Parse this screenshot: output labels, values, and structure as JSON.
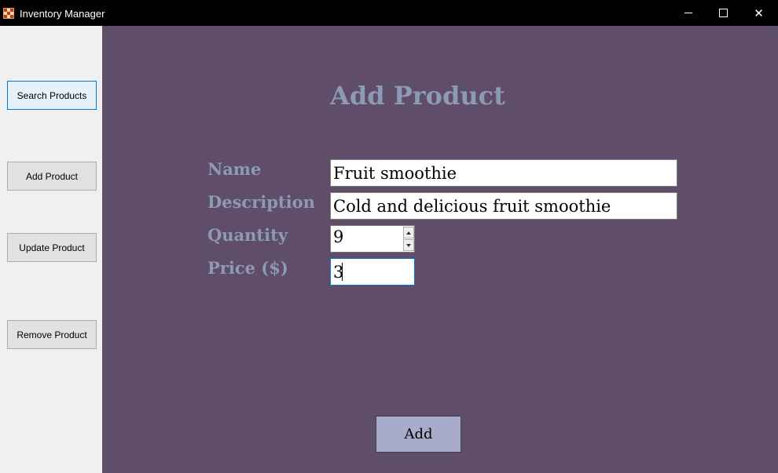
{
  "window": {
    "title": "Inventory Manager",
    "controls": {
      "minimize": "minimize-icon",
      "maximize": "maximize-icon",
      "close": "close-icon",
      "close_glyph": "✕"
    }
  },
  "sidebar": {
    "buttons": [
      {
        "label": "Search Products"
      },
      {
        "label": "Add Product"
      },
      {
        "label": "Update Product"
      },
      {
        "label": "Remove Product"
      }
    ]
  },
  "form": {
    "heading": "Add Product",
    "fields": {
      "name": {
        "label": "Name",
        "value": "Fruit smoothie"
      },
      "description": {
        "label": "Description",
        "value": "Cold and delicious fruit smoothie"
      },
      "quantity": {
        "label": "Quantity",
        "value": "9"
      },
      "price": {
        "label": "Price ($)",
        "value": "3"
      }
    },
    "submit_label": "Add"
  },
  "colors": {
    "panel_background": "#5f4d69",
    "label_text": "#8c9ab5",
    "add_button": "#a8abc9",
    "sidebar_background": "#f0f0f0",
    "focus_border": "#0078d7"
  }
}
